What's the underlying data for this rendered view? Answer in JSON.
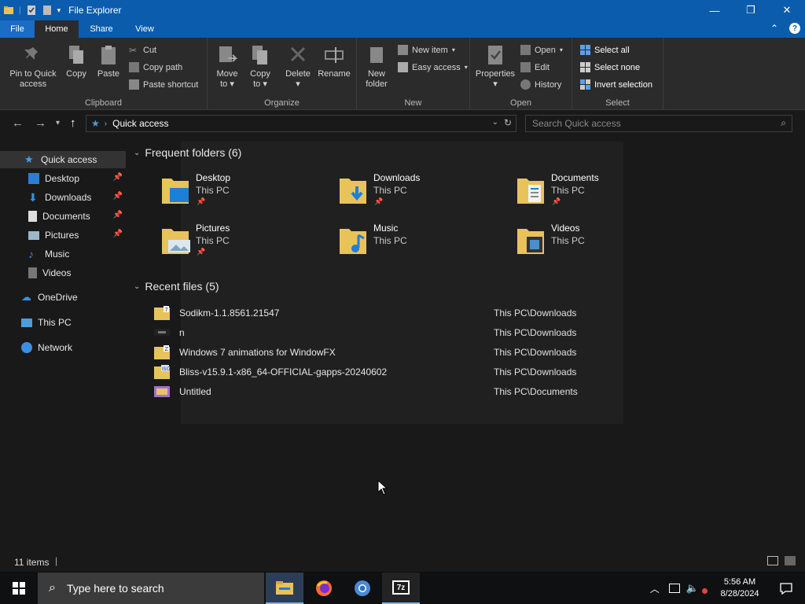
{
  "window": {
    "title": "File Explorer"
  },
  "tabs": {
    "file": "File",
    "home": "Home",
    "share": "Share",
    "view": "View"
  },
  "ribbon": {
    "clipboard": {
      "label": "Clipboard",
      "pin_line1": "Pin to Quick",
      "pin_line2": "access",
      "copy": "Copy",
      "paste": "Paste",
      "cut": "Cut",
      "copy_path": "Copy path",
      "paste_shortcut": "Paste shortcut"
    },
    "organize": {
      "label": "Organize",
      "move_to": "Move",
      "move_to2": "to",
      "copy_to": "Copy",
      "copy_to2": "to",
      "delete": "Delete",
      "rename": "Rename"
    },
    "new": {
      "label": "New",
      "new_folder1": "New",
      "new_folder2": "folder",
      "new_item": "New item",
      "easy_access": "Easy access"
    },
    "open": {
      "label": "Open",
      "properties": "Properties",
      "open": "Open",
      "edit": "Edit",
      "history": "History"
    },
    "select": {
      "label": "Select",
      "select_all": "Select all",
      "select_none": "Select none",
      "invert": "Invert selection"
    }
  },
  "address": {
    "path": "Quick access",
    "search_placeholder": "Search Quick access"
  },
  "nav": {
    "quick_access": "Quick access",
    "pinned": [
      "Desktop",
      "Downloads",
      "Documents",
      "Pictures"
    ],
    "music": "Music",
    "videos": "Videos",
    "onedrive": "OneDrive",
    "this_pc": "This PC",
    "network": "Network"
  },
  "frequent": {
    "header": "Frequent folders (6)",
    "folders": [
      {
        "name": "Desktop",
        "location": "This PC",
        "pinned": true
      },
      {
        "name": "Downloads",
        "location": "This PC",
        "pinned": true
      },
      {
        "name": "Documents",
        "location": "This PC",
        "pinned": true
      },
      {
        "name": "Pictures",
        "location": "This PC",
        "pinned": true
      },
      {
        "name": "Music",
        "location": "This PC",
        "pinned": false
      },
      {
        "name": "Videos",
        "location": "This PC",
        "pinned": false
      }
    ]
  },
  "recent": {
    "header": "Recent files (5)",
    "files": [
      {
        "name": "Sodikm-1.1.8561.21547",
        "location": "This PC\\Downloads"
      },
      {
        "name": "n",
        "location": "This PC\\Downloads"
      },
      {
        "name": "Windows 7 animations for WindowFX",
        "location": "This PC\\Downloads"
      },
      {
        "name": "Bliss-v15.9.1-x86_64-OFFICIAL-gapps-20240602",
        "location": "This PC\\Downloads"
      },
      {
        "name": "Untitled",
        "location": "This PC\\Documents"
      }
    ]
  },
  "status": {
    "items": "11 items"
  },
  "taskbar": {
    "search_placeholder": "Type here to search",
    "time": "5:56 AM",
    "date": "8/28/2024",
    "app_7z": "7z"
  },
  "colors": {
    "accent": "#0b5cad",
    "folder_yellow": "#e8c35a",
    "background": "#191919"
  }
}
